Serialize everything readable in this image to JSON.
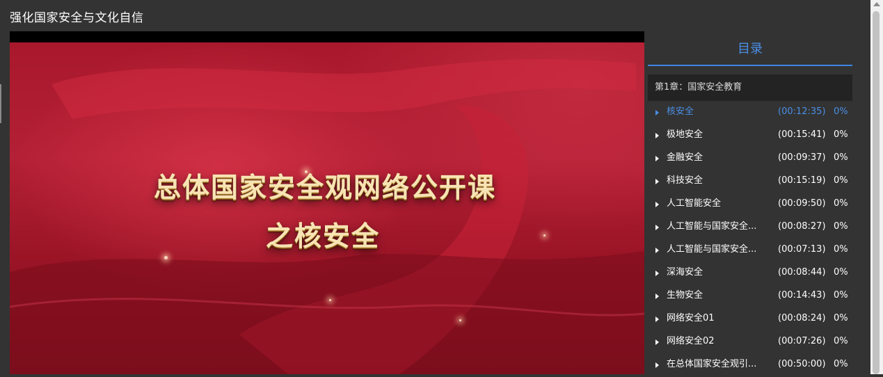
{
  "page": {
    "title": "强化国家安全与文化自信"
  },
  "video": {
    "headline_line1": "总体国家安全观网络公开课",
    "headline_line2": "之核安全"
  },
  "catalog": {
    "header": "目录",
    "chapter": "第1章：国家安全教育",
    "items": [
      {
        "title": "核安全",
        "duration": "(00:12:35)",
        "progress": "0%",
        "active": true
      },
      {
        "title": "极地安全",
        "duration": "(00:15:41)",
        "progress": "0%"
      },
      {
        "title": "金融安全",
        "duration": "(00:09:37)",
        "progress": "0%"
      },
      {
        "title": "科技安全",
        "duration": "(00:15:19)",
        "progress": "0%"
      },
      {
        "title": "人工智能安全",
        "duration": "(00:09:50)",
        "progress": "0%"
      },
      {
        "title": "人工智能与国家安全...",
        "duration": "(00:08:27)",
        "progress": "0%"
      },
      {
        "title": "人工智能与国家安全...",
        "duration": "(00:07:13)",
        "progress": "0%"
      },
      {
        "title": "深海安全",
        "duration": "(00:08:44)",
        "progress": "0%"
      },
      {
        "title": "生物安全",
        "duration": "(00:14:43)",
        "progress": "0%"
      },
      {
        "title": "网络安全01",
        "duration": "(00:08:24)",
        "progress": "0%"
      },
      {
        "title": "网络安全02",
        "duration": "(00:07:26)",
        "progress": "0%"
      },
      {
        "title": "在总体国家安全观引...",
        "duration": "(00:50:00)",
        "progress": "0%"
      }
    ]
  },
  "colors": {
    "accent": "#4a8fe6",
    "background": "#333333",
    "chapter_bg": "#232323"
  },
  "icons": {
    "item": "play-triangle-icon",
    "scroll": "scroll-up-arrow-icon"
  }
}
